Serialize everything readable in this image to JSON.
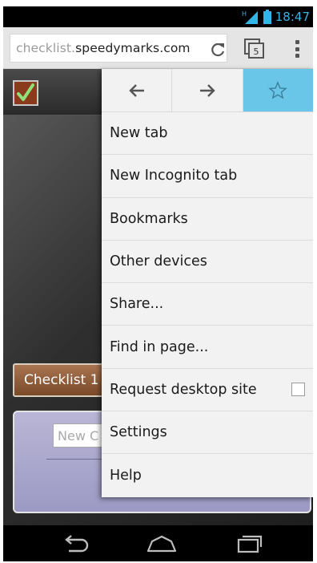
{
  "status_bar": {
    "time": "18:47",
    "network_label": "H",
    "accent_color": "#33b5e5"
  },
  "toolbar": {
    "url_subdomain": "checklist.",
    "url_domain": "speedymarks.com",
    "tab_count": "5",
    "icons": [
      "reload-icon",
      "tabs-icon",
      "overflow-menu-icon"
    ]
  },
  "page": {
    "logo_icon": "checkmark-icon",
    "checklist_tab_label": "Checklist 1",
    "new_item_placeholder": "New C"
  },
  "menu": {
    "nav": {
      "back_icon": "back-arrow-icon",
      "forward_icon": "forward-arrow-icon",
      "bookmark_icon": "star-icon",
      "bookmark_active_color": "#69c6e8"
    },
    "items": [
      {
        "label": "New tab"
      },
      {
        "label": "New Incognito tab"
      },
      {
        "label": "Bookmarks"
      },
      {
        "label": "Other devices"
      },
      {
        "label": "Share..."
      },
      {
        "label": "Find in page..."
      },
      {
        "label": "Request desktop site",
        "checked": false
      },
      {
        "label": "Settings"
      },
      {
        "label": "Help"
      }
    ]
  },
  "nav_bar": {
    "icons": [
      "back-icon",
      "home-icon",
      "recent-apps-icon"
    ]
  }
}
